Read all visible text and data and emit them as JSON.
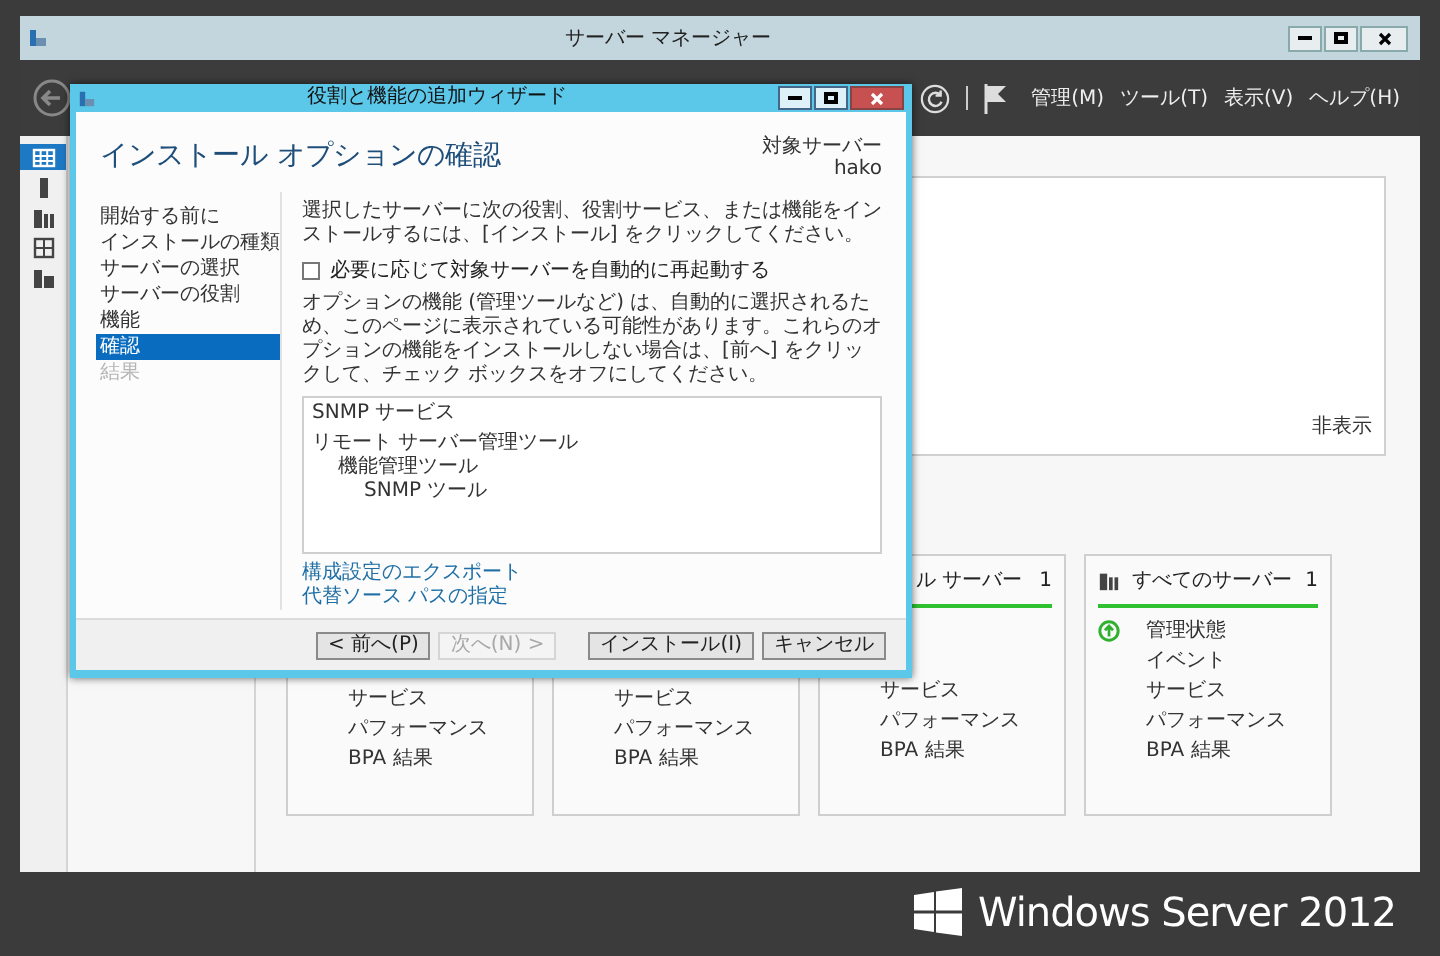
{
  "window": {
    "title": "サーバー マネージャー"
  },
  "toolbar": {
    "menus": [
      "管理(M)",
      "ツール(T)",
      "表示(V)",
      "ヘルプ(H)"
    ]
  },
  "nav_icons": [
    {
      "kind": "dashboard",
      "selected": true
    },
    {
      "kind": "server",
      "selected": false
    },
    {
      "kind": "servers",
      "selected": false
    },
    {
      "kind": "role",
      "selected": false
    },
    {
      "kind": "files",
      "selected": false
    }
  ],
  "panel": {
    "hide_link": "非表示"
  },
  "tiles": [
    {
      "items": [
        {
          "label": "サービス",
          "kind": "plain"
        },
        {
          "label": "パフォーマンス",
          "kind": "plain"
        },
        {
          "label": "BPA 結果",
          "kind": "plain"
        }
      ]
    },
    {
      "items": [
        {
          "label": "サービス",
          "kind": "plain"
        },
        {
          "label": "パフォーマンス",
          "kind": "plain"
        },
        {
          "label": "BPA 結果",
          "kind": "plain"
        }
      ]
    },
    {
      "title": "ル サーバー",
      "count": "1",
      "items": [
        {
          "label": "サービス",
          "kind": "plain"
        },
        {
          "label": "パフォーマンス",
          "kind": "plain"
        },
        {
          "label": "BPA 結果",
          "kind": "plain"
        }
      ]
    },
    {
      "title": "すべてのサーバー",
      "count": "1",
      "items": [
        {
          "label": "管理状態",
          "kind": "status"
        },
        {
          "label": "イベント",
          "kind": "plain"
        },
        {
          "label": "サービス",
          "kind": "plain"
        },
        {
          "label": "パフォーマンス",
          "kind": "plain"
        },
        {
          "label": "BPA 結果",
          "kind": "plain"
        }
      ]
    }
  ],
  "wizard": {
    "title": "役割と機能の追加ウィザード",
    "heading": "インストール オプションの確認",
    "target_label": "対象サーバー",
    "target_server": "hako",
    "steps": [
      {
        "label": "開始する前に",
        "selected": false,
        "disabled": false
      },
      {
        "label": "インストールの種類",
        "selected": false,
        "disabled": false
      },
      {
        "label": "サーバーの選択",
        "selected": false,
        "disabled": false
      },
      {
        "label": "サーバーの役割",
        "selected": false,
        "disabled": false
      },
      {
        "label": "機能",
        "selected": false,
        "disabled": false
      },
      {
        "label": "確認",
        "selected": true,
        "disabled": false
      },
      {
        "label": "結果",
        "selected": false,
        "disabled": true
      }
    ],
    "intro": "選択したサーバーに次の役割、役割サービス、または機能をインストールするには、[インストール] をクリックしてください。",
    "restart_checkbox": {
      "label": "必要に応じて対象サーバーを自動的に再起動する",
      "checked": false
    },
    "note": "オプションの機能 (管理ツールなど) は、自動的に選択されるため、このページに表示されている可能性があります。これらのオプションの機能をインストールしない場合は、[前へ] をクリックして、チェック ボックスをオフにしてください。",
    "selection": [
      {
        "label": "SNMP サービス"
      },
      {
        "label": "リモート サーバー管理ツール",
        "children": [
          {
            "label": "機能管理ツール",
            "children": [
              {
                "label": "SNMP ツール"
              }
            ]
          }
        ]
      }
    ],
    "links": [
      "構成設定のエクスポート",
      "代替ソース パスの指定"
    ],
    "buttons": [
      {
        "label": "< 前へ(P)",
        "disabled": false
      },
      {
        "label": "次へ(N) >",
        "disabled": true
      },
      {
        "label": "インストール(I)",
        "disabled": false
      },
      {
        "label": "キャンセル",
        "disabled": false
      }
    ]
  },
  "branding": {
    "product": "Windows Server 2012"
  }
}
